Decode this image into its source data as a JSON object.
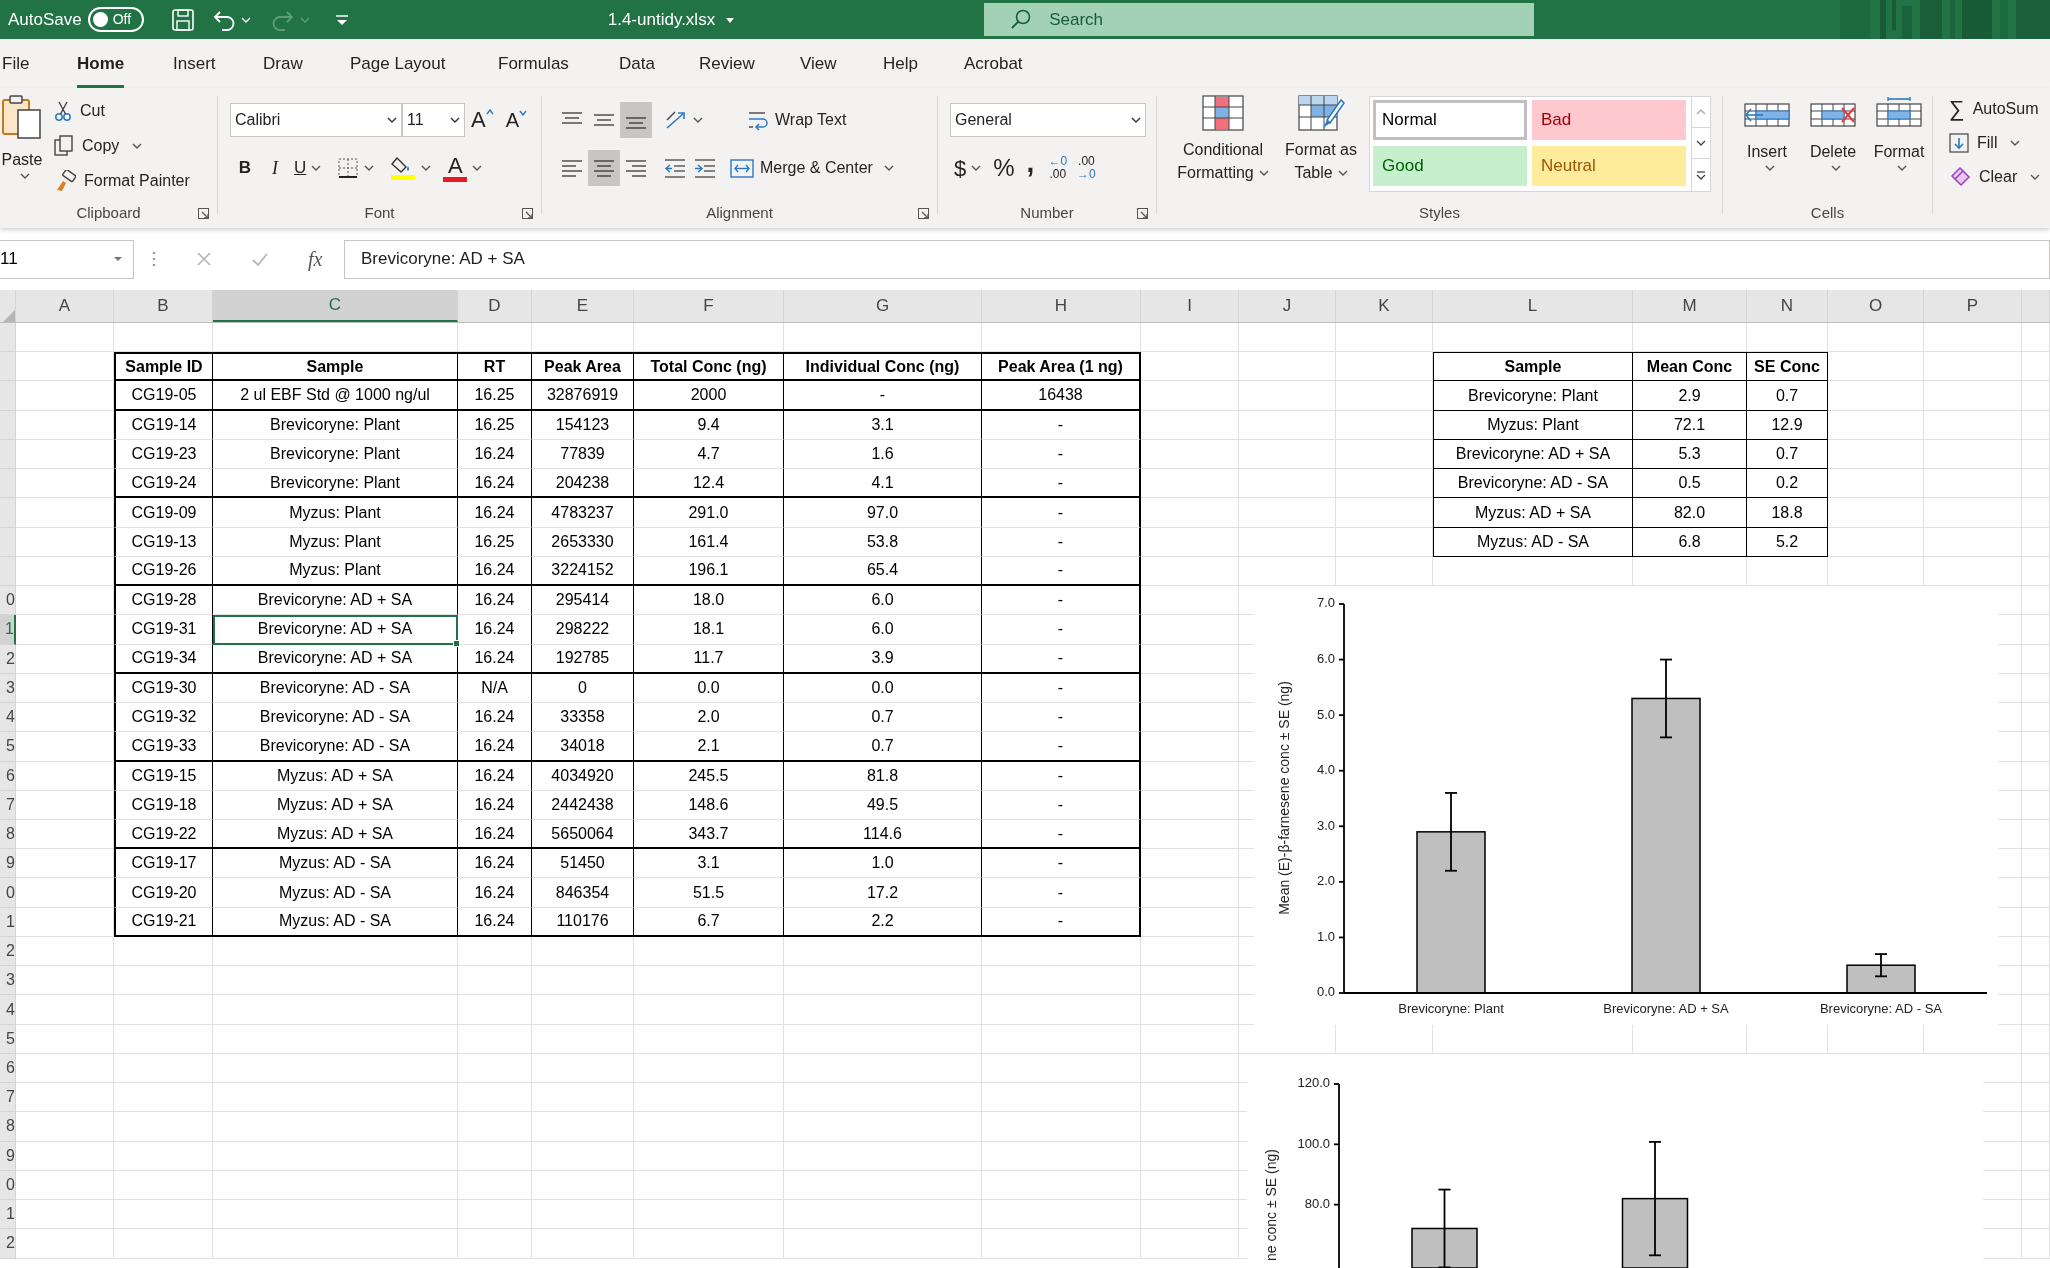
{
  "title_bar": {
    "autosave_label": "AutoSave",
    "autosave_on": false,
    "toggle_label": "Off",
    "quick_access": [
      {
        "kind": "save",
        "disabled": false
      },
      {
        "kind": "undo",
        "disabled": false
      },
      {
        "kind": "redo",
        "disabled": true
      },
      {
        "kind": "customize",
        "disabled": false
      }
    ],
    "file_name": "1.4-untidy.xlsx",
    "search_placeholder": "Search"
  },
  "tabs": [
    {
      "label": "File",
      "selected": false
    },
    {
      "label": "Home",
      "selected": true
    },
    {
      "label": "Insert",
      "selected": false
    },
    {
      "label": "Draw",
      "selected": false
    },
    {
      "label": "Page Layout",
      "selected": false
    },
    {
      "label": "Formulas",
      "selected": false
    },
    {
      "label": "Data",
      "selected": false
    },
    {
      "label": "Review",
      "selected": false
    },
    {
      "label": "View",
      "selected": false
    },
    {
      "label": "Help",
      "selected": false
    },
    {
      "label": "Acrobat",
      "selected": false
    }
  ],
  "ribbon": {
    "clipboard": {
      "label": "Clipboard",
      "launcher": true,
      "paste": "Paste",
      "cut": "Cut",
      "copy": "Copy",
      "format_painter": "Format Painter"
    },
    "font": {
      "label": "Font",
      "launcher": true,
      "font_name": "Calibri",
      "font_size": "11",
      "grow_font": "A",
      "shrink_font": "A",
      "bold": "B",
      "italic": "I",
      "underline": "U",
      "font_color": "A"
    },
    "alignment": {
      "label": "Alignment",
      "launcher": true,
      "vertical": [
        {
          "selected": false
        },
        {
          "selected": false
        },
        {
          "selected": true
        }
      ],
      "horizontal": [
        {
          "selected": false
        },
        {
          "selected": true
        },
        {
          "selected": false
        }
      ],
      "wrap_text": "Wrap Text",
      "merge_center": "Merge & Center"
    },
    "number": {
      "label": "Number",
      "launcher": true,
      "format": "General",
      "currency": "$",
      "percent": "%",
      "comma": ",",
      "increase_decimal": {
        "top": "←0",
        "bottom": ".00"
      },
      "decrease_decimal": {
        "top": ".00",
        "bottom": "→0"
      }
    },
    "styles": {
      "label": "Styles",
      "launcher": false,
      "conditional_formatting": [
        "Conditional",
        "Formatting"
      ],
      "format_as_table": [
        "Format as",
        "Table"
      ],
      "cell_styles": [
        {
          "label": "Normal",
          "kind": "normal",
          "selected": true
        },
        {
          "label": "Bad",
          "kind": "bad",
          "selected": false
        },
        {
          "label": "Good",
          "kind": "good",
          "selected": false
        },
        {
          "label": "Neutral",
          "kind": "neutral",
          "selected": false
        }
      ]
    },
    "cells": {
      "label": "Cells",
      "launcher": false,
      "buttons": [
        "Insert",
        "Delete",
        "Format"
      ]
    },
    "editing": {
      "sum_symbol": "∑",
      "autosum": "AutoSum",
      "fill": "Fill",
      "clear": "Clear"
    }
  },
  "formula_bar": {
    "name_box": "11",
    "fx": "fx",
    "formula": "Brevicoryne: AD + SA"
  },
  "column_headers": [
    {
      "label": "A",
      "selected": false
    },
    {
      "label": "B",
      "selected": false
    },
    {
      "label": "C",
      "selected": true
    },
    {
      "label": "D",
      "selected": false
    },
    {
      "label": "E",
      "selected": false
    },
    {
      "label": "F",
      "selected": false
    },
    {
      "label": "G",
      "selected": false
    },
    {
      "label": "H",
      "selected": false
    },
    {
      "label": "I",
      "selected": false
    },
    {
      "label": "J",
      "selected": false
    },
    {
      "label": "K",
      "selected": false
    },
    {
      "label": "L",
      "selected": false
    },
    {
      "label": "M",
      "selected": false
    },
    {
      "label": "N",
      "selected": false
    },
    {
      "label": "O",
      "selected": false
    },
    {
      "label": "P",
      "selected": false
    }
  ],
  "row_headers": [
    {
      "label": "0",
      "selected": false
    },
    {
      "label": "1",
      "selected": true
    },
    {
      "label": "2",
      "selected": false
    },
    {
      "label": "3",
      "selected": false
    },
    {
      "label": "4",
      "selected": false
    },
    {
      "label": "5",
      "selected": false
    },
    {
      "label": "6",
      "selected": false
    },
    {
      "label": "7",
      "selected": false
    },
    {
      "label": "8",
      "selected": false
    },
    {
      "label": "9",
      "selected": false
    },
    {
      "label": "0",
      "selected": false
    },
    {
      "label": "1",
      "selected": false
    },
    {
      "label": "2",
      "selected": false
    },
    {
      "label": "3",
      "selected": false
    },
    {
      "label": "4",
      "selected": false
    },
    {
      "label": "5",
      "selected": false
    },
    {
      "label": "6",
      "selected": false
    },
    {
      "label": "7",
      "selected": false
    },
    {
      "label": "8",
      "selected": false
    },
    {
      "label": "9",
      "selected": false
    },
    {
      "label": "0",
      "selected": false
    },
    {
      "label": "1",
      "selected": false
    },
    {
      "label": "2",
      "selected": false
    }
  ],
  "data_table": {
    "columns": [
      "Sample ID",
      "Sample",
      "RT",
      "Peak Area",
      "Total Conc (ng)",
      "Individual Conc (ng)",
      "Peak Area (1 ng)"
    ],
    "groups": [
      {
        "rows": [
          {
            "cells": [
              "CG19-05",
              "2 ul EBF Std @ 1000 ng/ul",
              "16.25",
              "32876919",
              "2000",
              "-",
              "16438"
            ],
            "selected": false
          }
        ]
      },
      {
        "rows": [
          {
            "cells": [
              "CG19-14",
              "Brevicoryne: Plant",
              "16.25",
              "154123",
              "9.4",
              "3.1",
              "-"
            ],
            "selected": false
          },
          {
            "cells": [
              "CG19-23",
              "Brevicoryne: Plant",
              "16.24",
              "77839",
              "4.7",
              "1.6",
              "-"
            ],
            "selected": false
          },
          {
            "cells": [
              "CG19-24",
              "Brevicoryne: Plant",
              "16.24",
              "204238",
              "12.4",
              "4.1",
              "-"
            ],
            "selected": false
          }
        ]
      },
      {
        "rows": [
          {
            "cells": [
              "CG19-09",
              "Myzus: Plant",
              "16.24",
              "4783237",
              "291.0",
              "97.0",
              "-"
            ],
            "selected": false
          },
          {
            "cells": [
              "CG19-13",
              "Myzus: Plant",
              "16.25",
              "2653330",
              "161.4",
              "53.8",
              "-"
            ],
            "selected": false
          },
          {
            "cells": [
              "CG19-26",
              "Myzus: Plant",
              "16.24",
              "3224152",
              "196.1",
              "65.4",
              "-"
            ],
            "selected": false
          }
        ]
      },
      {
        "rows": [
          {
            "cells": [
              "CG19-28",
              "Brevicoryne: AD + SA",
              "16.24",
              "295414",
              "18.0",
              "6.0",
              "-"
            ],
            "selected": false
          },
          {
            "cells": [
              "CG19-31",
              "Brevicoryne: AD + SA",
              "16.24",
              "298222",
              "18.1",
              "6.0",
              "-"
            ],
            "selected": true
          },
          {
            "cells": [
              "CG19-34",
              "Brevicoryne: AD + SA",
              "16.24",
              "192785",
              "11.7",
              "3.9",
              "-"
            ],
            "selected": false
          }
        ]
      },
      {
        "rows": [
          {
            "cells": [
              "CG19-30",
              "Brevicoryne: AD - SA",
              "N/A",
              "0",
              "0.0",
              "0.0",
              "-"
            ],
            "selected": false
          },
          {
            "cells": [
              "CG19-32",
              "Brevicoryne: AD - SA",
              "16.24",
              "33358",
              "2.0",
              "0.7",
              "-"
            ],
            "selected": false
          },
          {
            "cells": [
              "CG19-33",
              "Brevicoryne: AD - SA",
              "16.24",
              "34018",
              "2.1",
              "0.7",
              "-"
            ],
            "selected": false
          }
        ]
      },
      {
        "rows": [
          {
            "cells": [
              "CG19-15",
              "Myzus: AD + SA",
              "16.24",
              "4034920",
              "245.5",
              "81.8",
              "-"
            ],
            "selected": false
          },
          {
            "cells": [
              "CG19-18",
              "Myzus: AD + SA",
              "16.24",
              "2442438",
              "148.6",
              "49.5",
              "-"
            ],
            "selected": false
          },
          {
            "cells": [
              "CG19-22",
              "Myzus: AD + SA",
              "16.24",
              "5650064",
              "343.7",
              "114.6",
              "-"
            ],
            "selected": false
          }
        ]
      },
      {
        "rows": [
          {
            "cells": [
              "CG19-17",
              "Myzus: AD - SA",
              "16.24",
              "51450",
              "3.1",
              "1.0",
              "-"
            ],
            "selected": false
          },
          {
            "cells": [
              "CG19-20",
              "Myzus: AD - SA",
              "16.24",
              "846354",
              "51.5",
              "17.2",
              "-"
            ],
            "selected": false
          },
          {
            "cells": [
              "CG19-21",
              "Myzus: AD - SA",
              "16.24",
              "110176",
              "6.7",
              "2.2",
              "-"
            ],
            "selected": false
          }
        ]
      }
    ]
  },
  "summary_table": {
    "columns": [
      "Sample",
      "Mean Conc",
      "SE Conc"
    ],
    "rows": [
      [
        "Brevicoryne: Plant",
        "2.9",
        "0.7"
      ],
      [
        "Myzus: Plant",
        "72.1",
        "12.9"
      ],
      [
        "Brevicoryne: AD + SA",
        "5.3",
        "0.7"
      ],
      [
        "Brevicoryne: AD - SA",
        "0.5",
        "0.2"
      ],
      [
        "Myzus: AD + SA",
        "82.0",
        "18.8"
      ],
      [
        "Myzus: AD - SA",
        "6.8",
        "5.2"
      ]
    ]
  },
  "charts": [
    {
      "chart_data": {
        "type": "bar",
        "ylabel": "Mean (E)-β-farnesene conc ± SE (ng)",
        "categories": [
          "Brevicoryne: Plant",
          "Brevicoryne: AD + SA",
          "Brevicoryne: AD - SA"
        ],
        "series": [
          {
            "color": "#bfbfbf",
            "values": [
              2.9,
              5.3,
              0.5
            ],
            "errors": [
              0.7,
              0.7,
              0.2
            ]
          }
        ],
        "ylim": [
          0,
          7
        ],
        "yticks": [
          {
            "value": 0,
            "label": "0.0"
          },
          {
            "value": 1,
            "label": "1.0"
          },
          {
            "value": 2,
            "label": "2.0"
          },
          {
            "value": 3,
            "label": "3.0"
          },
          {
            "value": 4,
            "label": "4.0"
          },
          {
            "value": 5,
            "label": "5.0"
          },
          {
            "value": 6,
            "label": "6.0"
          },
          {
            "value": 7,
            "label": "7.0"
          }
        ]
      }
    },
    {
      "chart_data": {
        "type": "bar",
        "ylabel": "ne conc ± SE (ng)",
        "series": [
          {
            "color": "#bfbfbf",
            "values": [
              72.1,
              82.0
            ],
            "errors": [
              12.9,
              18.8
            ]
          }
        ],
        "ylim": [
          59,
          120
        ],
        "yticks": [
          {
            "value": 80,
            "label": "80.0"
          },
          {
            "value": 100,
            "label": "100.0"
          },
          {
            "value": 120,
            "label": "120.0"
          }
        ]
      }
    }
  ]
}
